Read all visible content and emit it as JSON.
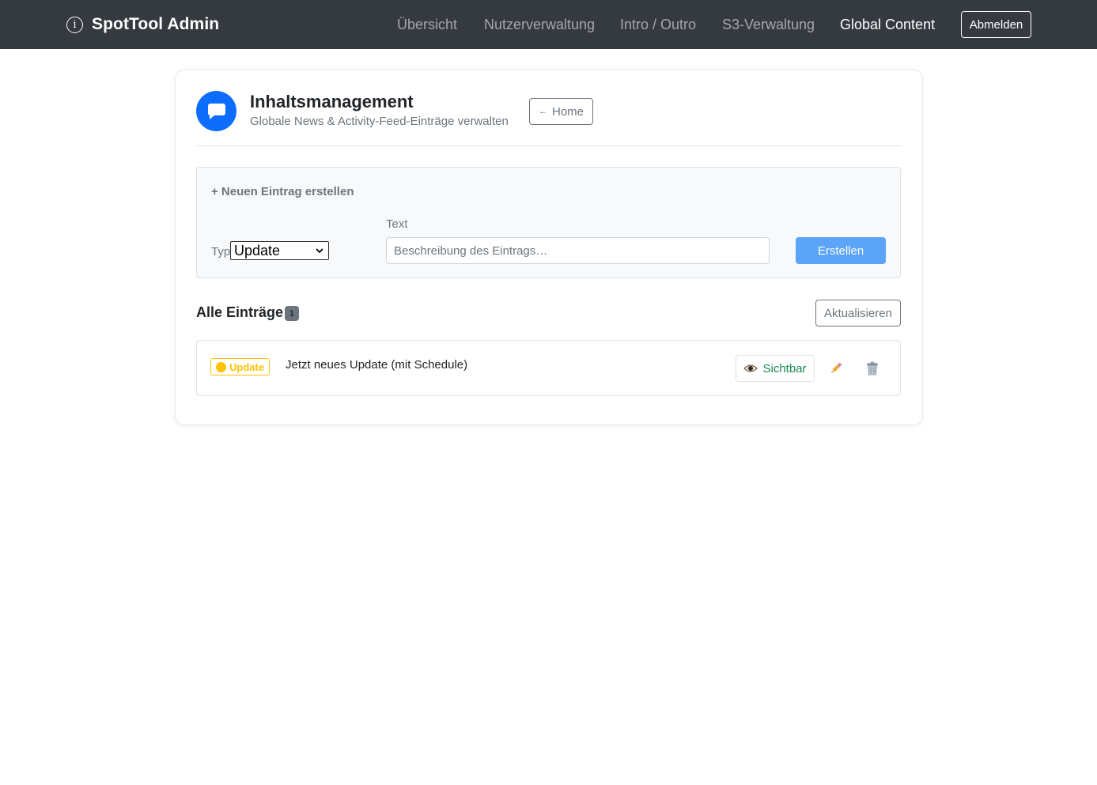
{
  "navbar": {
    "brand": "SpotTool Admin",
    "brand_icon": "info-circle-icon",
    "links": [
      "Übersicht",
      "Nutzerverwaltung",
      "Intro / Outro",
      "S3-Verwaltung",
      "Global Content"
    ],
    "active_link": "Global Content",
    "logout_label": "Abmelden",
    "background_color": "#343a40"
  },
  "header": {
    "icon": "chat-bubble-icon",
    "title": "Inhaltsmanagement",
    "subtitle": "Globale News & Activity-Feed-Einträge verwalten",
    "home_label": "Home",
    "home_arrow": "←",
    "accent_color": "#0d6efd"
  },
  "create": {
    "title": "+ Neuen Eintrag erstellen",
    "type_label": "Typ",
    "type_selected": "Update",
    "text_label": "Text",
    "text_placeholder": "Beschreibung des Eintrags…",
    "text_value": "",
    "submit_label": "Erstellen",
    "submit_color": "#5ba4f7"
  },
  "entries": {
    "title": "Alle Einträge",
    "count": "1",
    "refresh_label": "Aktualisieren",
    "items": [
      {
        "type_label": "Update",
        "type_icon": "yellow-circle-icon",
        "type_color": "#ffc107",
        "text": "Jetzt neues Update (mit Schedule)",
        "visibility_label": "Sichtbar",
        "visibility_icon": "eye-icon",
        "visibility_color": "#198754",
        "edit_icon": "pencil-icon",
        "delete_icon": "trash-icon"
      }
    ]
  }
}
